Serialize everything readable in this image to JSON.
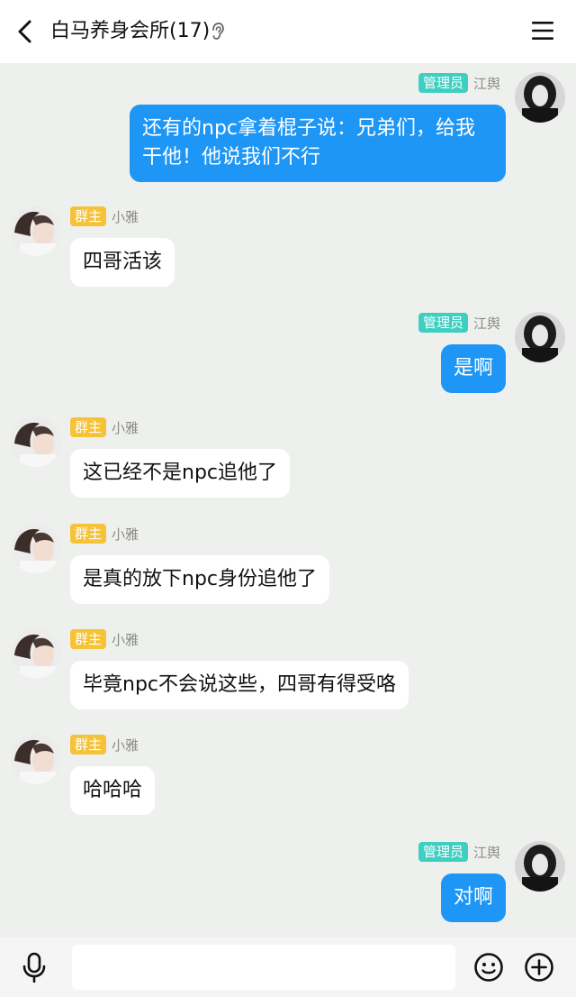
{
  "header": {
    "title": "白马养身会所(17)",
    "back_icon": "chevron-left-icon",
    "ear_icon": "ear-icon",
    "menu_icon": "menu-icon"
  },
  "colors": {
    "self_bubble": "#1e96f5",
    "other_bubble": "#ffffff",
    "owner_badge": "#f6c237",
    "admin_badge": "#3ecfc1",
    "background": "#eef0ed"
  },
  "messages": [
    {
      "side": "right",
      "role": "管理员",
      "name": "江舆",
      "text": "还有的npc拿着棍子说：兄弟们，给我干他！他说我们不行"
    },
    {
      "side": "left",
      "role": "群主",
      "name": "小雅",
      "text": "四哥活该"
    },
    {
      "side": "right",
      "role": "管理员",
      "name": "江舆",
      "text": "是啊"
    },
    {
      "side": "left",
      "role": "群主",
      "name": "小雅",
      "text": "这已经不是npc追他了"
    },
    {
      "side": "left",
      "role": "群主",
      "name": "小雅",
      "text": "是真的放下npc身份追他了"
    },
    {
      "side": "left",
      "role": "群主",
      "name": "小雅",
      "text": "毕竟npc不会说这些，四哥有得受咯"
    },
    {
      "side": "left",
      "role": "群主",
      "name": "小雅",
      "text": "哈哈哈"
    },
    {
      "side": "right",
      "role": "管理员",
      "name": "江舆",
      "text": "对啊"
    }
  ],
  "composer": {
    "placeholder": "",
    "mic_icon": "microphone-icon",
    "emoji_icon": "emoji-icon",
    "plus_icon": "plus-icon"
  }
}
